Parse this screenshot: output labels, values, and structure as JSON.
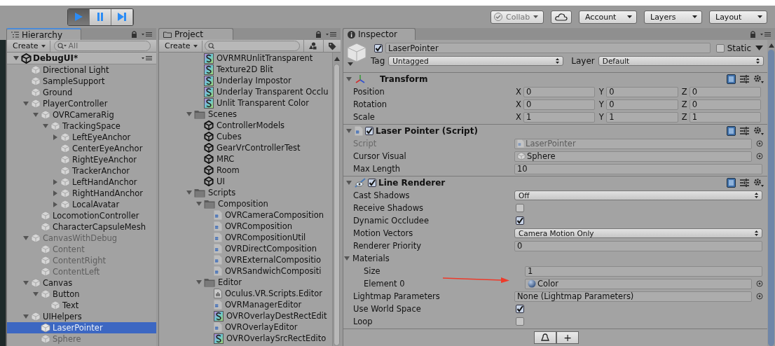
{
  "toolbar": {
    "play_buttons": [
      {
        "kind": "play",
        "selected": true
      },
      {
        "kind": "pause",
        "selected": false
      },
      {
        "kind": "step",
        "selected": false
      }
    ],
    "collab": {
      "label": "Collab",
      "disabled": true
    },
    "account": "Account",
    "layers": "Layers",
    "layout": "Layout"
  },
  "hierarchy": {
    "tab": "Hierarchy",
    "create": "Create",
    "search_placeholder": "All",
    "scene": {
      "label": "DebugUI*",
      "expanded": true
    },
    "tree": [
      {
        "label": "Directional Light",
        "active": true,
        "selected": false
      },
      {
        "label": "SampleSupport",
        "active": true,
        "selected": false
      },
      {
        "label": "Ground",
        "active": true,
        "selected": false
      },
      {
        "label": "PlayerController",
        "active": true,
        "selected": false,
        "expanded": true,
        "children": [
          {
            "label": "OVRCameraRig",
            "active": true,
            "selected": false,
            "expanded": true,
            "children": [
              {
                "label": "TrackingSpace",
                "active": true,
                "selected": false,
                "expanded": true,
                "children": [
                  {
                    "label": "LeftEyeAnchor",
                    "active": true,
                    "selected": false,
                    "expanded": false
                  },
                  {
                    "label": "CenterEyeAnchor",
                    "active": true,
                    "selected": false
                  },
                  {
                    "label": "RightEyeAnchor",
                    "active": true,
                    "selected": false
                  },
                  {
                    "label": "TrackerAnchor",
                    "active": true,
                    "selected": false
                  },
                  {
                    "label": "LeftHandAnchor",
                    "active": true,
                    "selected": false,
                    "expanded": false
                  },
                  {
                    "label": "RightHandAnchor",
                    "active": true,
                    "selected": false,
                    "expanded": false
                  },
                  {
                    "label": "LocalAvatar",
                    "active": true,
                    "selected": false,
                    "expanded": false
                  }
                ]
              }
            ]
          },
          {
            "label": "LocomotionController",
            "active": true,
            "selected": false
          },
          {
            "label": "CharacterCapsuleMesh",
            "active": true,
            "selected": false
          }
        ]
      },
      {
        "label": "CanvasWithDebug",
        "active": false,
        "selected": false,
        "expanded": true,
        "children": [
          {
            "label": "Content",
            "active": false,
            "selected": false
          },
          {
            "label": "ContentRight",
            "active": false,
            "selected": false
          },
          {
            "label": "ContentLeft",
            "active": false,
            "selected": false
          }
        ]
      },
      {
        "label": "Canvas",
        "active": true,
        "selected": false,
        "expanded": true,
        "children": [
          {
            "label": "Button",
            "active": true,
            "selected": false,
            "expanded": true,
            "children": [
              {
                "label": "Text",
                "active": true,
                "selected": false
              }
            ]
          }
        ]
      },
      {
        "label": "UIHelpers",
        "active": true,
        "selected": false,
        "expanded": true,
        "children": [
          {
            "label": "LaserPointer",
            "active": true,
            "selected": true
          },
          {
            "label": "Sphere",
            "active": false,
            "selected": false
          }
        ]
      }
    ]
  },
  "project": {
    "tab": "Project",
    "create": "Create",
    "scrolled_folder_items": [
      {
        "kind": "shader",
        "label": "OVRMRUnlitTransparent",
        "selected": false
      },
      {
        "kind": "shader",
        "label": "Texture2D Blit",
        "selected": false
      },
      {
        "kind": "shader",
        "label": "Underlay Impostor",
        "selected": false
      },
      {
        "kind": "shader",
        "label": "Underlay Transparent Occlu",
        "selected": false
      },
      {
        "kind": "shader",
        "label": "Unlit Transparent Color",
        "selected": false
      }
    ],
    "tree": [
      {
        "kind": "folder",
        "label": "Scenes",
        "selected": false,
        "expanded": true,
        "children": [
          {
            "kind": "scene",
            "label": "ControllerModels",
            "selected": false
          },
          {
            "kind": "scene",
            "label": "Cubes",
            "selected": false
          },
          {
            "kind": "scene",
            "label": "GearVrControllerTest",
            "selected": false
          },
          {
            "kind": "scene",
            "label": "MRC",
            "selected": false
          },
          {
            "kind": "scene",
            "label": "Room",
            "selected": false
          },
          {
            "kind": "scene",
            "label": "UI",
            "selected": false
          }
        ]
      },
      {
        "kind": "folder",
        "label": "Scripts",
        "selected": false,
        "expanded": true,
        "children": [
          {
            "kind": "folder",
            "label": "Composition",
            "selected": false,
            "expanded": true,
            "children": [
              {
                "kind": "script",
                "label": "OVRCameraComposition",
                "selected": false
              },
              {
                "kind": "script",
                "label": "OVRComposition",
                "selected": false
              },
              {
                "kind": "script",
                "label": "OVRCompositionUtil",
                "selected": false
              },
              {
                "kind": "script",
                "label": "OVRDirectComposition",
                "selected": false
              },
              {
                "kind": "script",
                "label": "OVRExternalCompositio",
                "selected": false
              },
              {
                "kind": "script",
                "label": "OVRSandwichCompositi",
                "selected": false
              }
            ]
          },
          {
            "kind": "folder",
            "label": "Editor",
            "selected": false,
            "expanded": true,
            "children": [
              {
                "kind": "assembly",
                "label": "Oculus.VR.Scripts.Editor",
                "selected": false
              },
              {
                "kind": "script",
                "label": "OVRManagerEditor",
                "selected": false
              },
              {
                "kind": "shader",
                "label": "OVROverlayDestRectEdit",
                "selected": false
              },
              {
                "kind": "script",
                "label": "OVROverlayEditor",
                "selected": false
              },
              {
                "kind": "shader",
                "label": "OVROverlaySrcRectEdito",
                "selected": false
              }
            ]
          }
        ]
      }
    ]
  },
  "inspector": {
    "tab": "Inspector",
    "object": {
      "active": true,
      "name": "LaserPointer",
      "static": false,
      "static_label": "Static",
      "tag_label": "Tag",
      "tag": "Untagged",
      "layer_label": "Layer",
      "layer": "Default"
    },
    "components": [
      {
        "kind": "transform",
        "title": "Transform",
        "expanded": true,
        "rows": [
          {
            "kind": "vector",
            "label": "Position",
            "values": [
              {
                "axis": "X",
                "value": "0"
              },
              {
                "axis": "Y",
                "value": "0"
              },
              {
                "axis": "Z",
                "value": "0"
              }
            ]
          },
          {
            "kind": "vector",
            "label": "Rotation",
            "values": [
              {
                "axis": "X",
                "value": "0"
              },
              {
                "axis": "Y",
                "value": "0"
              },
              {
                "axis": "Z",
                "value": "0"
              }
            ]
          },
          {
            "kind": "vector",
            "label": "Scale",
            "values": [
              {
                "axis": "X",
                "value": "1"
              },
              {
                "axis": "Y",
                "value": "1"
              },
              {
                "axis": "Z",
                "value": "1"
              }
            ]
          }
        ]
      },
      {
        "kind": "script",
        "title": "Laser Pointer (Script)",
        "enabled": true,
        "expanded": true,
        "rows": [
          {
            "kind": "script_reference",
            "label": "Script",
            "value": "LaserPointer",
            "disabled": true
          },
          {
            "kind": "gameobject_reference",
            "label": "Cursor Visual",
            "value": "Sphere",
            "disabled": false
          },
          {
            "kind": "number",
            "label": "Max Length",
            "value": "10",
            "disabled": false
          }
        ]
      },
      {
        "kind": "line_renderer",
        "title": "Line Renderer",
        "enabled": true,
        "expanded": true,
        "rows": [
          {
            "kind": "dropdown",
            "label": "Cast Shadows",
            "value": "Off"
          },
          {
            "kind": "checkbox",
            "label": "Receive Shadows",
            "checked": false
          },
          {
            "kind": "checkbox",
            "label": "Dynamic Occludee",
            "checked": true
          },
          {
            "kind": "dropdown",
            "label": "Motion Vectors",
            "value": "Camera Motion Only"
          },
          {
            "kind": "number",
            "label": "Renderer Priority",
            "value": "0"
          },
          {
            "kind": "foldout",
            "label": "Materials",
            "expanded": true,
            "children": [
              {
                "kind": "number",
                "label": "Size",
                "value": "1"
              },
              {
                "kind": "material_reference",
                "label": "Element 0",
                "value": "Color"
              }
            ]
          },
          {
            "kind": "asset_reference",
            "label": "Lightmap Parameters",
            "value": "None (Lightmap Parameters)"
          },
          {
            "kind": "checkbox",
            "label": "Use World Space",
            "checked": true
          },
          {
            "kind": "checkbox",
            "label": "Loop",
            "checked": false
          }
        ]
      }
    ],
    "add_button": "+"
  }
}
